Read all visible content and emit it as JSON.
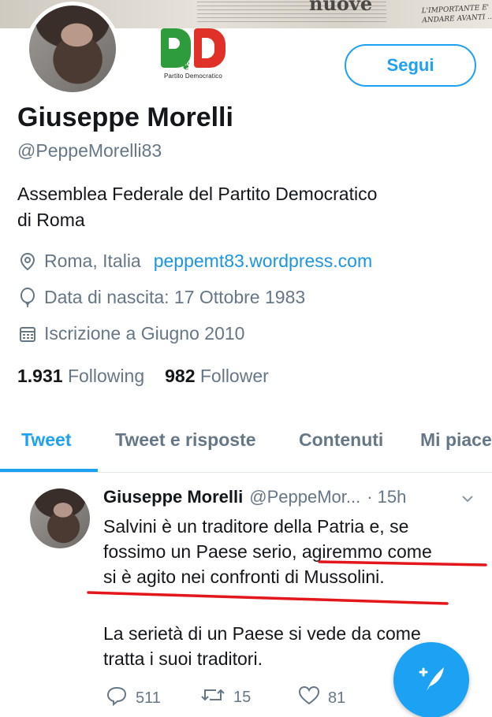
{
  "banner": {
    "headline": "nuove",
    "scribble": "L'IMPORTANTE E'\nANDARE AVANTI ..."
  },
  "logo": {
    "text": "Partito Democratico"
  },
  "follow_button": {
    "label": "Segui"
  },
  "profile": {
    "name": "Giuseppe Morelli",
    "handle": "@PeppeMorelli83",
    "bio_line1": "Assemblea Federale del Partito Democratico",
    "bio_line2": "di Roma",
    "location": "Roma, Italia",
    "website": "peppemt83.wordpress.com",
    "birthday": "Data di nascita: 17 Ottobre 1983",
    "joined": "Iscrizione a Giugno 2010",
    "following_count": "1.931",
    "following_label": "Following",
    "followers_count": "982",
    "followers_label": "Follower"
  },
  "tabs": [
    {
      "label": "Tweet",
      "active": true
    },
    {
      "label": "Tweet e risposte"
    },
    {
      "label": "Contenuti"
    },
    {
      "label": "Mi piace"
    }
  ],
  "tweet": {
    "author_name": "Giuseppe Morelli",
    "author_handle": "@PeppeMor...",
    "time": "· 15h",
    "line1": "Salvini è un traditore della Patria e, se",
    "line2": "fossimo un Paese serio, agiremmo come",
    "line3": "si è agito nei confronti di Mussolini.",
    "line4": "La serietà di un Paese si vede da come",
    "line5": "tratta i suoi traditori.",
    "replies": "511",
    "retweets": "15",
    "likes": "81"
  },
  "colors": {
    "accent": "#1da1f2",
    "link": "#1b95e0",
    "muted": "#657786",
    "underline_annotation": "#e3171b"
  },
  "icons": {
    "location": "location-pin-icon",
    "birthday": "balloon-icon",
    "joined": "calendar-icon",
    "reply": "reply-icon",
    "retweet": "retweet-icon",
    "like": "heart-icon",
    "compose": "compose-tweet-icon",
    "more": "chevron-down-icon"
  }
}
